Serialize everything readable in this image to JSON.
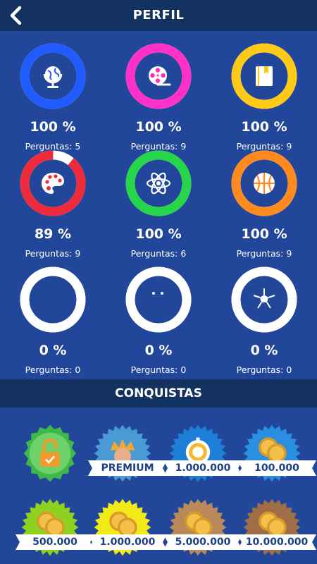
{
  "header": {
    "title": "PERFIL"
  },
  "categories": [
    {
      "icon": "globe-icon",
      "color": "#1f5bff",
      "progress": 1.0,
      "percent": "100 %",
      "label": "Perguntas:",
      "count": "5"
    },
    {
      "icon": "film-reel-icon",
      "color": "#ff31c8",
      "progress": 1.0,
      "percent": "100 %",
      "label": "Perguntas:",
      "count": "9"
    },
    {
      "icon": "book-icon",
      "color": "#ffc918",
      "progress": 1.0,
      "percent": "100 %",
      "label": "Perguntas:",
      "count": "9"
    },
    {
      "icon": "palette-icon",
      "color": "#ee2a3b",
      "progress": 0.89,
      "percent": "89 %",
      "label": "Perguntas:",
      "count": "9"
    },
    {
      "icon": "atom-icon",
      "color": "#26d54a",
      "progress": 1.0,
      "percent": "100 %",
      "label": "Perguntas:",
      "count": "6"
    },
    {
      "icon": "basketball-icon",
      "color": "#ff8a1f",
      "progress": 1.0,
      "percent": "100 %",
      "label": "Perguntas:",
      "count": "9"
    },
    {
      "icon": "music-note-icon",
      "color": "#ffffff",
      "progress": 0,
      "percent": "0 %",
      "label": "Perguntas:",
      "count": "0"
    },
    {
      "icon": "movie-camera-icon",
      "color": "#ffffff",
      "progress": 0,
      "percent": "0 %",
      "label": "Perguntas:",
      "count": "0"
    },
    {
      "icon": "soccer-ball-icon",
      "color": "#ffffff",
      "progress": 0,
      "percent": "0 %",
      "label": "Perguntas:",
      "count": "0"
    }
  ],
  "achievements_section": {
    "title": "CONQUISTAS"
  },
  "achievements": [
    {
      "icon": "padlock-unlocked-icon",
      "color": "#3fb84a",
      "ribbon": ""
    },
    {
      "icon": "crown-icon",
      "color": "#4a9ad6",
      "ribbon": "PREMIUM"
    },
    {
      "icon": "stopwatch-icon",
      "color": "#1e7fd8",
      "ribbon": "1.000.000"
    },
    {
      "icon": "coin-icon",
      "color": "#2a8fe0",
      "ribbon": "100.000"
    },
    {
      "icon": "coin-icon",
      "color": "#8ed11f",
      "ribbon": "500.000"
    },
    {
      "icon": "coin-icon",
      "color": "#f2ea18",
      "ribbon": "1.000.000"
    },
    {
      "icon": "coin-icon",
      "color": "#b8895a",
      "ribbon": "5.000.000"
    },
    {
      "icon": "coin-icon",
      "color": "#a06e46",
      "ribbon": "10.000.000"
    }
  ]
}
